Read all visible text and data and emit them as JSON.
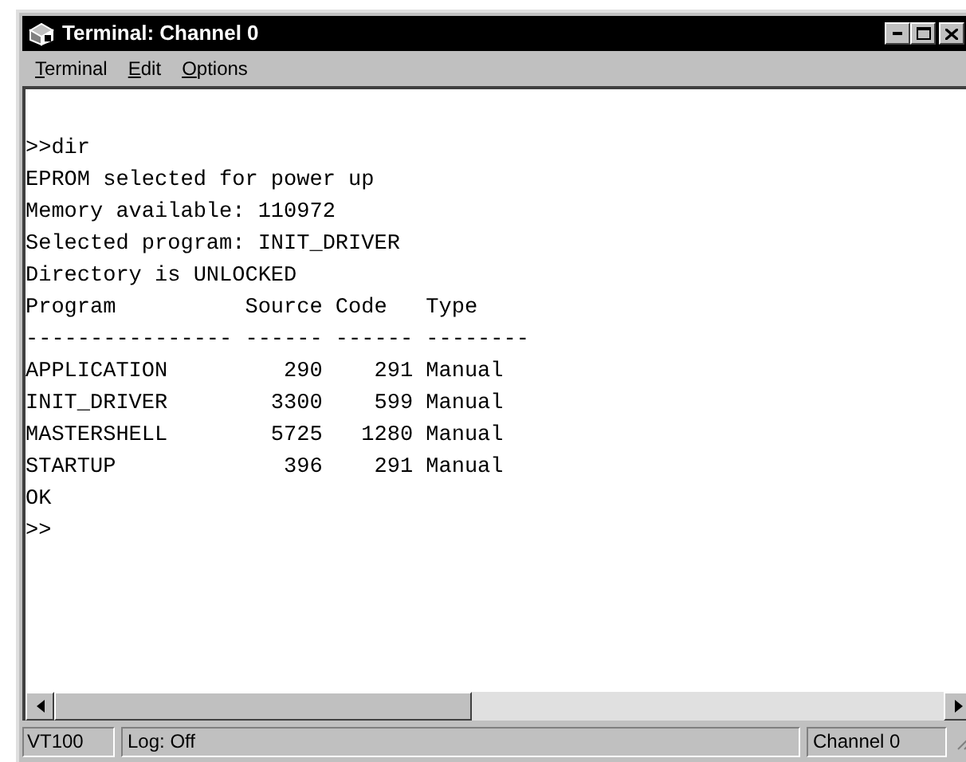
{
  "window": {
    "title": "Terminal: Channel 0"
  },
  "menu": [
    {
      "accelerator": "T",
      "rest": "erminal"
    },
    {
      "accelerator": "E",
      "rest": "dit"
    },
    {
      "accelerator": "O",
      "rest": "ptions"
    }
  ],
  "terminal": {
    "lines": [
      ">>dir",
      "EPROM selected for power up",
      "Memory available: 110972",
      "Selected program: INIT_DRIVER",
      "Directory is UNLOCKED",
      "Program          Source Code   Type",
      "---------------- ------ ------ --------",
      "APPLICATION         290    291 Manual",
      "INIT_DRIVER        3300    599 Manual",
      "MASTERSHELL        5725   1280 Manual",
      "STARTUP             396    291 Manual",
      "OK",
      ">>"
    ]
  },
  "status_bar": [
    "VT100",
    "Log: Off",
    "Channel 0"
  ]
}
